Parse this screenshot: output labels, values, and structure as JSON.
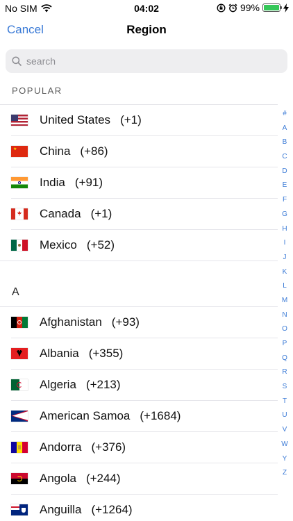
{
  "status_bar": {
    "carrier": "No SIM",
    "time": "04:02",
    "battery": "99%"
  },
  "nav": {
    "cancel_label": "Cancel",
    "title": "Region"
  },
  "search": {
    "placeholder": "search"
  },
  "popular": {
    "header": "POPULAR",
    "items": [
      {
        "name": "United States",
        "code": "(+1)",
        "flag": "us"
      },
      {
        "name": "China",
        "code": "(+86)",
        "flag": "cn"
      },
      {
        "name": "India",
        "code": "(+91)",
        "flag": "in"
      },
      {
        "name": "Canada",
        "code": "(+1)",
        "flag": "ca"
      },
      {
        "name": "Mexico",
        "code": "(+52)",
        "flag": "mx"
      }
    ]
  },
  "section_a": {
    "header": "A",
    "items": [
      {
        "name": "Afghanistan",
        "code": "(+93)",
        "flag": "af"
      },
      {
        "name": "Albania",
        "code": "(+355)",
        "flag": "al"
      },
      {
        "name": "Algeria",
        "code": "(+213)",
        "flag": "dz"
      },
      {
        "name": "American Samoa",
        "code": "(+1684)",
        "flag": "as"
      },
      {
        "name": "Andorra",
        "code": "(+376)",
        "flag": "ad"
      },
      {
        "name": "Angola",
        "code": "(+244)",
        "flag": "ao"
      },
      {
        "name": "Anguilla",
        "code": "(+1264)",
        "flag": "ai"
      }
    ]
  },
  "index": [
    "#",
    "A",
    "B",
    "C",
    "D",
    "E",
    "F",
    "G",
    "H",
    "I",
    "J",
    "K",
    "L",
    "M",
    "N",
    "O",
    "P",
    "Q",
    "R",
    "S",
    "T",
    "U",
    "V",
    "W",
    "Y",
    "Z"
  ],
  "colors": {
    "accent": "#3a7ad6",
    "battery": "#35c759",
    "search_bg": "#eeeef0",
    "separator": "#e5e5ea"
  }
}
